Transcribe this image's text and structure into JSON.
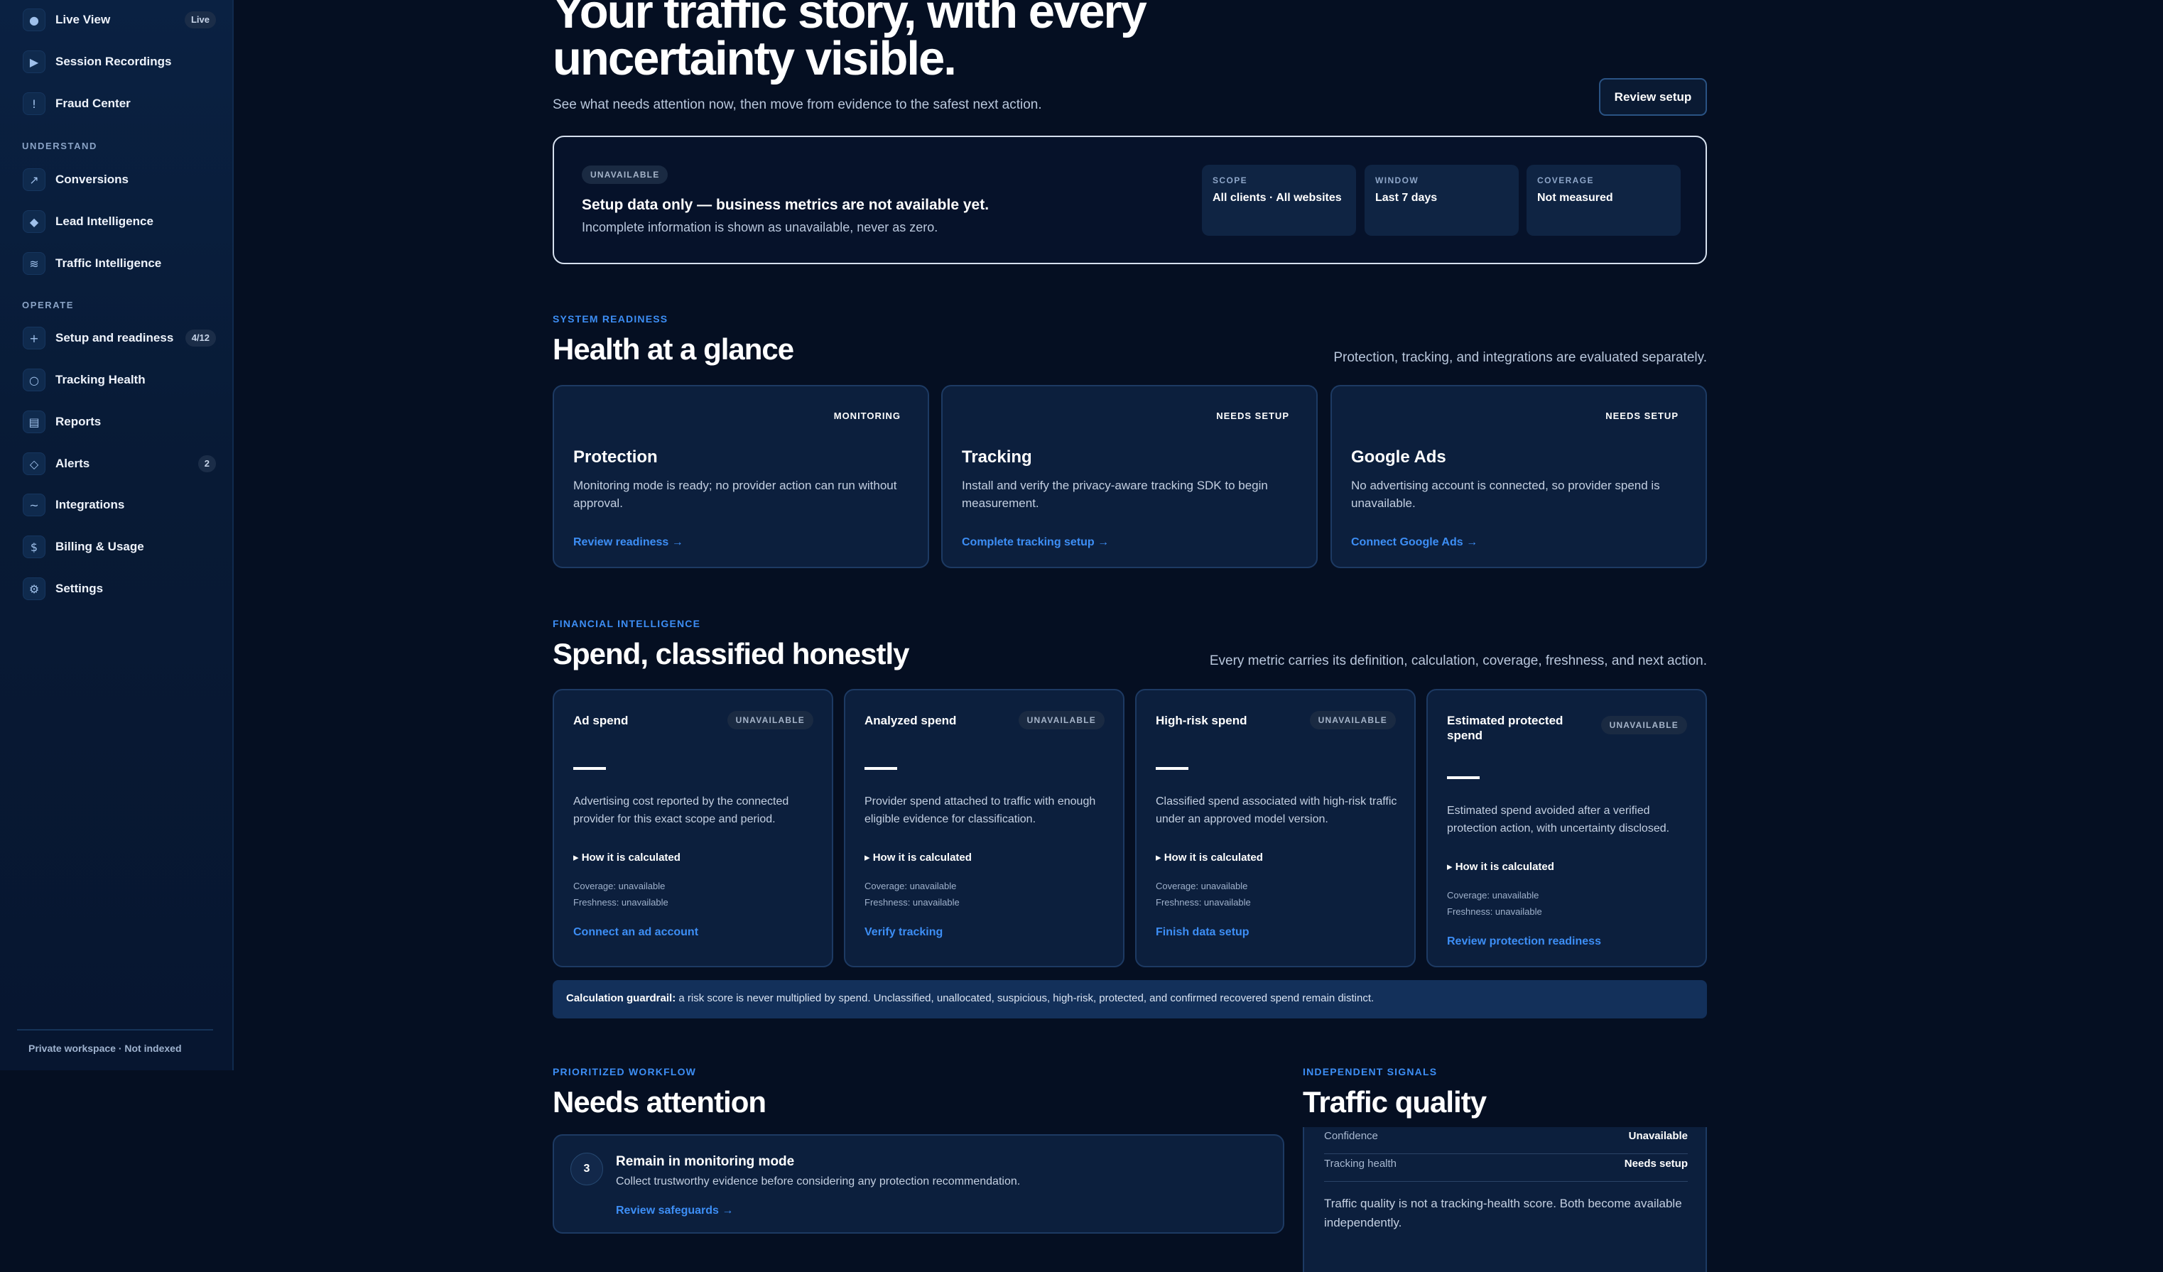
{
  "sidebar": {
    "items": [
      {
        "label": "Live View",
        "icon": "dot-icon",
        "glyph": "●",
        "badge": "Live"
      },
      {
        "label": "Session Recordings",
        "icon": "play-icon",
        "glyph": "▶",
        "badge": null
      },
      {
        "label": "Fraud Center",
        "icon": "alert-icon",
        "glyph": "!",
        "badge": null
      },
      {
        "label": "Conversions",
        "icon": "trend-icon",
        "glyph": "↗",
        "badge": null
      },
      {
        "label": "Lead Intelligence",
        "icon": "diamond-icon",
        "glyph": "◆",
        "badge": null
      },
      {
        "label": "Traffic Intelligence",
        "icon": "waves-icon",
        "glyph": "≋",
        "badge": null
      },
      {
        "label": "Setup and readiness",
        "icon": "plus-icon",
        "glyph": "+",
        "badge": "4/12"
      },
      {
        "label": "Tracking Health",
        "icon": "circle-icon",
        "glyph": "○",
        "badge": null
      },
      {
        "label": "Reports",
        "icon": "report-icon",
        "glyph": "▤",
        "badge": null
      },
      {
        "label": "Alerts",
        "icon": "diamond-outline-icon",
        "glyph": "◇",
        "badge": "2"
      },
      {
        "label": "Integrations",
        "icon": "link-icon",
        "glyph": "~",
        "badge": null
      },
      {
        "label": "Billing & Usage",
        "icon": "dollar-icon",
        "glyph": "$",
        "badge": null
      },
      {
        "label": "Settings",
        "icon": "gear-icon",
        "glyph": "⚙",
        "badge": null
      }
    ],
    "sections": {
      "understand": "UNDERSTAND",
      "operate": "OPERATE"
    },
    "footer": "Private workspace · Not indexed"
  },
  "hero": {
    "title": "Your traffic story, with every uncertainty visible.",
    "subtitle": "See what needs attention now, then move from evidence to the safest next action.",
    "review_button": "Review setup"
  },
  "status": {
    "pill": "UNAVAILABLE",
    "title": "Setup data only — business metrics are not available yet.",
    "desc": "Incomplete information is shown as unavailable, never as zero.",
    "meta": [
      {
        "label": "SCOPE",
        "value": "All clients · All websites"
      },
      {
        "label": "WINDOW",
        "value": "Last 7 days"
      },
      {
        "label": "COVERAGE",
        "value": "Not measured"
      }
    ]
  },
  "health": {
    "eyebrow": "SYSTEM READINESS",
    "title": "Health at a glance",
    "note": "Protection, tracking, and integrations are evaluated separately.",
    "cards": [
      {
        "status": "MONITORING",
        "title": "Protection",
        "desc": "Monitoring mode is ready; no provider action can run without approval.",
        "link": "Review readiness →"
      },
      {
        "status": "NEEDS SETUP",
        "title": "Tracking",
        "desc": "Install and verify the privacy-aware tracking SDK to begin measurement.",
        "link": "Complete tracking setup →"
      },
      {
        "status": "NEEDS SETUP",
        "title": "Google Ads",
        "desc": "No advertising account is connected, so provider spend is unavailable.",
        "link": "Connect Google Ads →"
      }
    ]
  },
  "financial": {
    "eyebrow": "FINANCIAL INTELLIGENCE",
    "title": "Spend, classified honestly",
    "note": "Every metric carries its definition, calculation, coverage, freshness, and next action.",
    "cards": [
      {
        "title": "Ad spend",
        "pill": "UNAVAILABLE",
        "value": "—",
        "desc": "Advertising cost reported by the connected provider for this exact scope and period.",
        "how": "How it is calculated",
        "coverage": "Coverage: unavailable",
        "freshness": "Freshness: unavailable",
        "link": "Connect an ad account"
      },
      {
        "title": "Analyzed spend",
        "pill": "UNAVAILABLE",
        "value": "—",
        "desc": "Provider spend attached to traffic with enough eligible evidence for classification.",
        "how": "How it is calculated",
        "coverage": "Coverage: unavailable",
        "freshness": "Freshness: unavailable",
        "link": "Verify tracking"
      },
      {
        "title": "High-risk spend",
        "pill": "UNAVAILABLE",
        "value": "—",
        "desc": "Classified spend associated with high-risk traffic under an approved model version.",
        "how": "How it is calculated",
        "coverage": "Coverage: unavailable",
        "freshness": "Freshness: unavailable",
        "link": "Finish data setup"
      },
      {
        "title": "Estimated protected spend",
        "pill": "UNAVAILABLE",
        "value": "—",
        "desc": "Estimated spend avoided after a verified protection action, with uncertainty disclosed.",
        "how": "How it is calculated",
        "coverage": "Coverage: unavailable",
        "freshness": "Freshness: unavailable",
        "link": "Review protection readiness"
      }
    ],
    "guardrail_label": "Calculation guardrail:",
    "guardrail_text": " a risk score is never multiplied by spend. Unclassified, unallocated, suspicious, high-risk, protected, and confirmed recovered spend remain distinct."
  },
  "attention": {
    "eyebrow": "PRIORITIZED WORKFLOW",
    "title": "Needs attention",
    "item": {
      "number": "3",
      "title": "Remain in monitoring mode",
      "desc": "Collect trustworthy evidence before considering any protection recommendation.",
      "link": "Review safeguards →"
    }
  },
  "traffic": {
    "eyebrow": "INDEPENDENT SIGNALS",
    "title": "Traffic quality",
    "rows": [
      {
        "key": "Confidence",
        "value": "Unavailable"
      },
      {
        "key": "Tracking health",
        "value": "Needs setup"
      }
    ],
    "note": "Traffic quality is not a tracking-health score. Both become available independently."
  },
  "colors": {
    "accent": "#3d8ef5",
    "background": "#050f22",
    "card": "#0c1f3d"
  }
}
